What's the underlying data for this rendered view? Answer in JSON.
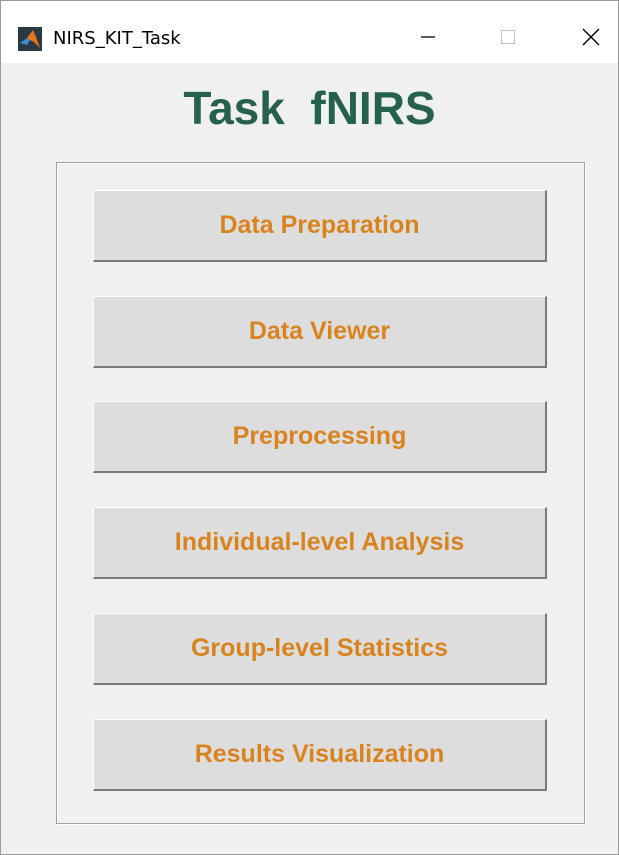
{
  "window": {
    "title": "NIRS_KIT_Task",
    "app_icon": "matlab-icon",
    "controls": {
      "minimize_icon": "minimize-icon",
      "maximize_icon": "maximize-icon",
      "close_icon": "close-icon"
    }
  },
  "main": {
    "heading": "Task  fNIRS",
    "buttons": [
      {
        "label": "Data Preparation"
      },
      {
        "label": "Data Viewer"
      },
      {
        "label": "Preprocessing"
      },
      {
        "label": "Individual-level Analysis"
      },
      {
        "label": "Group-level Statistics"
      },
      {
        "label": "Results Visualization"
      }
    ]
  },
  "colors": {
    "heading": "#26614d",
    "button_text": "#d9831f",
    "button_face": "#dddddd",
    "background": "#f0f0f0"
  }
}
